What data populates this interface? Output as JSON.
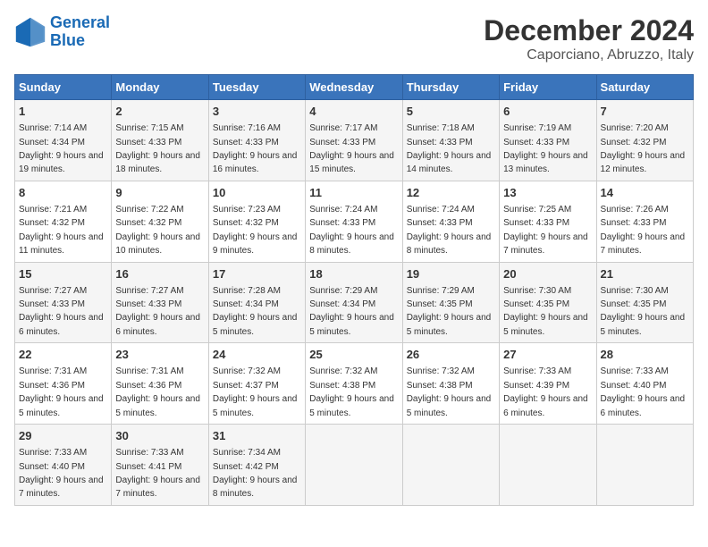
{
  "header": {
    "logo_line1": "General",
    "logo_line2": "Blue",
    "title": "December 2024",
    "subtitle": "Caporciano, Abruzzo, Italy"
  },
  "columns": [
    "Sunday",
    "Monday",
    "Tuesday",
    "Wednesday",
    "Thursday",
    "Friday",
    "Saturday"
  ],
  "weeks": [
    [
      {
        "day": "1",
        "sunrise": "7:14 AM",
        "sunset": "4:34 PM",
        "daylight": "9 hours and 19 minutes."
      },
      {
        "day": "2",
        "sunrise": "7:15 AM",
        "sunset": "4:33 PM",
        "daylight": "9 hours and 18 minutes."
      },
      {
        "day": "3",
        "sunrise": "7:16 AM",
        "sunset": "4:33 PM",
        "daylight": "9 hours and 16 minutes."
      },
      {
        "day": "4",
        "sunrise": "7:17 AM",
        "sunset": "4:33 PM",
        "daylight": "9 hours and 15 minutes."
      },
      {
        "day": "5",
        "sunrise": "7:18 AM",
        "sunset": "4:33 PM",
        "daylight": "9 hours and 14 minutes."
      },
      {
        "day": "6",
        "sunrise": "7:19 AM",
        "sunset": "4:33 PM",
        "daylight": "9 hours and 13 minutes."
      },
      {
        "day": "7",
        "sunrise": "7:20 AM",
        "sunset": "4:32 PM",
        "daylight": "9 hours and 12 minutes."
      }
    ],
    [
      {
        "day": "8",
        "sunrise": "7:21 AM",
        "sunset": "4:32 PM",
        "daylight": "9 hours and 11 minutes."
      },
      {
        "day": "9",
        "sunrise": "7:22 AM",
        "sunset": "4:32 PM",
        "daylight": "9 hours and 10 minutes."
      },
      {
        "day": "10",
        "sunrise": "7:23 AM",
        "sunset": "4:32 PM",
        "daylight": "9 hours and 9 minutes."
      },
      {
        "day": "11",
        "sunrise": "7:24 AM",
        "sunset": "4:33 PM",
        "daylight": "9 hours and 8 minutes."
      },
      {
        "day": "12",
        "sunrise": "7:24 AM",
        "sunset": "4:33 PM",
        "daylight": "9 hours and 8 minutes."
      },
      {
        "day": "13",
        "sunrise": "7:25 AM",
        "sunset": "4:33 PM",
        "daylight": "9 hours and 7 minutes."
      },
      {
        "day": "14",
        "sunrise": "7:26 AM",
        "sunset": "4:33 PM",
        "daylight": "9 hours and 7 minutes."
      }
    ],
    [
      {
        "day": "15",
        "sunrise": "7:27 AM",
        "sunset": "4:33 PM",
        "daylight": "9 hours and 6 minutes."
      },
      {
        "day": "16",
        "sunrise": "7:27 AM",
        "sunset": "4:33 PM",
        "daylight": "9 hours and 6 minutes."
      },
      {
        "day": "17",
        "sunrise": "7:28 AM",
        "sunset": "4:34 PM",
        "daylight": "9 hours and 5 minutes."
      },
      {
        "day": "18",
        "sunrise": "7:29 AM",
        "sunset": "4:34 PM",
        "daylight": "9 hours and 5 minutes."
      },
      {
        "day": "19",
        "sunrise": "7:29 AM",
        "sunset": "4:35 PM",
        "daylight": "9 hours and 5 minutes."
      },
      {
        "day": "20",
        "sunrise": "7:30 AM",
        "sunset": "4:35 PM",
        "daylight": "9 hours and 5 minutes."
      },
      {
        "day": "21",
        "sunrise": "7:30 AM",
        "sunset": "4:35 PM",
        "daylight": "9 hours and 5 minutes."
      }
    ],
    [
      {
        "day": "22",
        "sunrise": "7:31 AM",
        "sunset": "4:36 PM",
        "daylight": "9 hours and 5 minutes."
      },
      {
        "day": "23",
        "sunrise": "7:31 AM",
        "sunset": "4:36 PM",
        "daylight": "9 hours and 5 minutes."
      },
      {
        "day": "24",
        "sunrise": "7:32 AM",
        "sunset": "4:37 PM",
        "daylight": "9 hours and 5 minutes."
      },
      {
        "day": "25",
        "sunrise": "7:32 AM",
        "sunset": "4:38 PM",
        "daylight": "9 hours and 5 minutes."
      },
      {
        "day": "26",
        "sunrise": "7:32 AM",
        "sunset": "4:38 PM",
        "daylight": "9 hours and 5 minutes."
      },
      {
        "day": "27",
        "sunrise": "7:33 AM",
        "sunset": "4:39 PM",
        "daylight": "9 hours and 6 minutes."
      },
      {
        "day": "28",
        "sunrise": "7:33 AM",
        "sunset": "4:40 PM",
        "daylight": "9 hours and 6 minutes."
      }
    ],
    [
      {
        "day": "29",
        "sunrise": "7:33 AM",
        "sunset": "4:40 PM",
        "daylight": "9 hours and 7 minutes."
      },
      {
        "day": "30",
        "sunrise": "7:33 AM",
        "sunset": "4:41 PM",
        "daylight": "9 hours and 7 minutes."
      },
      {
        "day": "31",
        "sunrise": "7:34 AM",
        "sunset": "4:42 PM",
        "daylight": "9 hours and 8 minutes."
      },
      null,
      null,
      null,
      null
    ]
  ]
}
